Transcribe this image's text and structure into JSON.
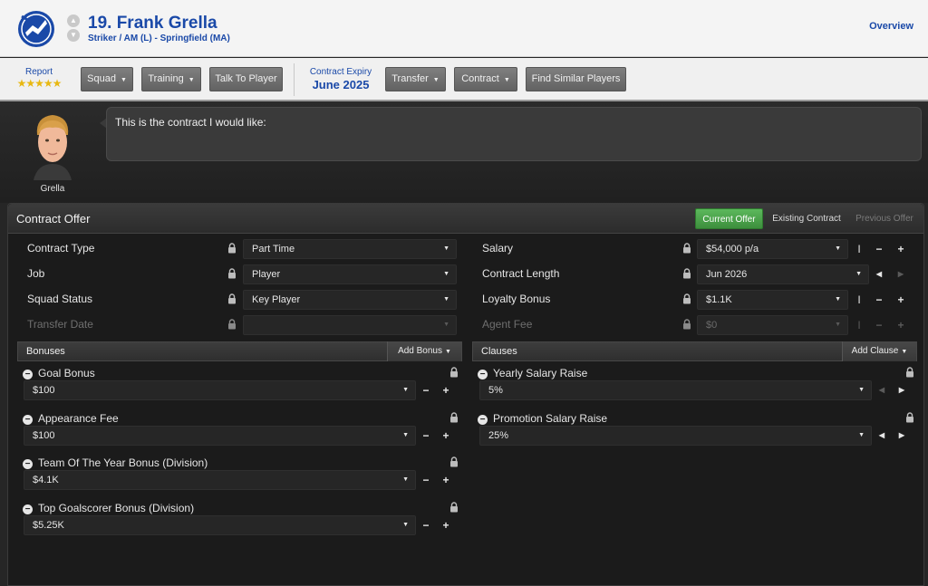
{
  "header": {
    "player_title": "19. Frank Grella",
    "player_subtitle": "Striker / AM (L) - Springfield (MA)",
    "overview_link": "Overview"
  },
  "toolbar": {
    "report_label": "Report",
    "report_stars": 5,
    "squad_label": "Squad",
    "training_label": "Training",
    "talk_label": "Talk To Player",
    "expiry_label": "Contract Expiry",
    "expiry_value": "June 2025",
    "transfer_label": "Transfer",
    "contract_label": "Contract",
    "similar_label": "Find Similar Players"
  },
  "message": {
    "text": "This is the contract I would like:",
    "player_name": "Grella"
  },
  "panel": {
    "title": "Contract Offer",
    "tabs": [
      {
        "label": "Current Offer"
      },
      {
        "label": "Existing Contract"
      },
      {
        "label": "Previous Offer"
      }
    ]
  },
  "fields_left": [
    {
      "label": "Contract Type",
      "value": "Part Time"
    },
    {
      "label": "Job",
      "value": "Player"
    },
    {
      "label": "Squad Status",
      "value": "Key Player"
    },
    {
      "label": "Transfer Date",
      "value": ""
    }
  ],
  "fields_right": [
    {
      "label": "Salary",
      "value": "$54,000 p/a"
    },
    {
      "label": "Contract Length",
      "value": "Jun 2026"
    },
    {
      "label": "Loyalty Bonus",
      "value": "$1.1K"
    },
    {
      "label": "Agent Fee",
      "value": "$0"
    }
  ],
  "bonuses": {
    "title": "Bonuses",
    "add_label": "Add Bonus",
    "items": [
      {
        "name": "Goal Bonus",
        "value": "$100"
      },
      {
        "name": "Appearance Fee",
        "value": "$100"
      },
      {
        "name": "Team Of The Year Bonus (Division)",
        "value": "$4.1K"
      },
      {
        "name": "Top Goalscorer Bonus (Division)",
        "value": "$5.25K"
      }
    ]
  },
  "clauses": {
    "title": "Clauses",
    "add_label": "Add Clause",
    "items": [
      {
        "name": "Yearly Salary Raise",
        "value": "5%"
      },
      {
        "name": "Promotion Salary Raise",
        "value": "25%"
      }
    ]
  },
  "icons": {
    "lock": "lock-icon",
    "text_cursor": "text-cursor-icon",
    "minus": "minus-icon",
    "plus": "plus-icon",
    "dropdown": "dropdown-arrow-icon",
    "arrow_left": "arrow-left-icon",
    "arrow_right": "arrow-right-icon",
    "collapse": "collapse-icon",
    "crest": "club-crest-icon",
    "star": "star-icon"
  },
  "colors": {
    "accent_blue": "#1a49a8",
    "active_tab_green": "#4ca64c",
    "star_gold": "#e8b812"
  }
}
